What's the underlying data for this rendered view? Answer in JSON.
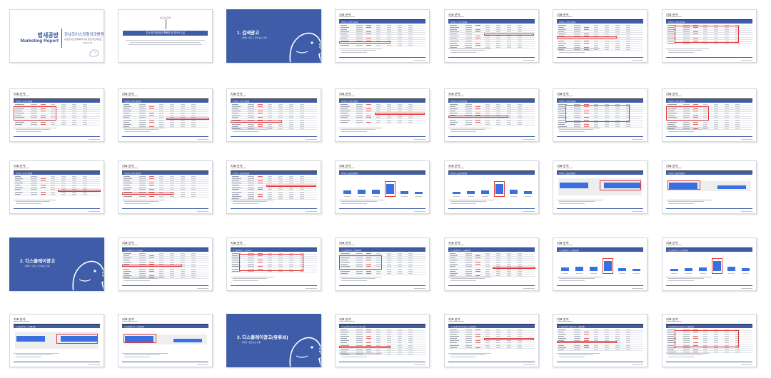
{
  "colors": {
    "brand_blue": "#3f5ca8",
    "highlight_red": "#e03a3a",
    "bar_blue": "#3a6fe0"
  },
  "cover": {
    "title_line1": "법새공방",
    "title_line2": "Marketing Report",
    "hospital": "강남조이스정형외과병원",
    "subtitle": "(강남조이스정형외과) 1월 월간 광고리포트",
    "date": "2024.02.05"
  },
  "intro": {
    "label": "보고서 요약",
    "band_text": "주요 광고채널별 진행현황 및 데이터 수집"
  },
  "sections": [
    {
      "title": "1. 검색광고",
      "subtitle": "구역명 : 블로그 검색 광고 현황"
    },
    {
      "title": "2. 디스플레이광고",
      "subtitle": "구역명 : 브랜드 검색 광고 현황"
    },
    {
      "title": "3. 디스플레이광고(유튜브)",
      "subtitle": "구역명 : 영상 광고 현황"
    }
  ],
  "content_title": "지표 분석",
  "content_headers": {
    "search": "검색광고_키워드별현황",
    "search_total": "검색광고_월별전체현황",
    "display": "디스플레이광고_기본현황",
    "display_detail": "디스플레이광고_소재별현황",
    "youtube": "디스플레이광고(유튜브)_기본현황",
    "youtube_detail": "디스플레이광고(유튜브)_소재별현황"
  }
}
